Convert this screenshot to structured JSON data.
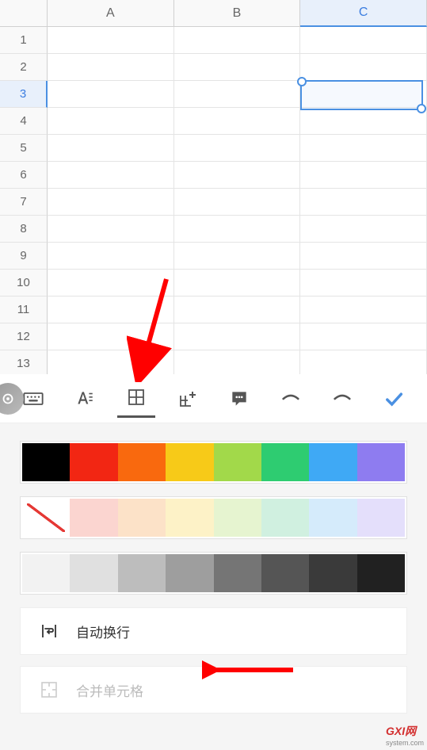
{
  "grid": {
    "columns": [
      "A",
      "B",
      "C"
    ],
    "rows": [
      "1",
      "2",
      "3",
      "4",
      "5",
      "6",
      "7",
      "8",
      "9",
      "10",
      "11",
      "12",
      "13"
    ],
    "selected_column_index": 2,
    "selected_row_index": 2
  },
  "toolbar": {
    "items": [
      {
        "name": "keyboard-icon"
      },
      {
        "name": "font-icon"
      },
      {
        "name": "cell-fill-icon",
        "active": true
      },
      {
        "name": "insert-icon"
      },
      {
        "name": "comment-icon"
      },
      {
        "name": "undo-icon"
      },
      {
        "name": "redo-icon"
      },
      {
        "name": "confirm-icon"
      }
    ]
  },
  "panel": {
    "fill_colors": [
      "#000000",
      "#f22613",
      "#f9690e",
      "#f7ca18",
      "#a2d94a",
      "#2ecc71",
      "#3fa9f5",
      "#8e7cf0"
    ],
    "light_colors": [
      "nofill",
      "#fbd5d0",
      "#fce2c8",
      "#fdf2c7",
      "#e6f4d0",
      "#d0f0e0",
      "#d5ebfb",
      "#e4dffb"
    ],
    "gray_colors": [
      "#f2f2f2",
      "#e0e0e0",
      "#bdbdbd",
      "#9e9e9e",
      "#757575",
      "#555555",
      "#3a3a3a",
      "#212121"
    ],
    "wrap_label": "自动换行",
    "merge_label": "合并单元格"
  },
  "watermark": {
    "main": "GXI网",
    "sub": "system.com"
  }
}
